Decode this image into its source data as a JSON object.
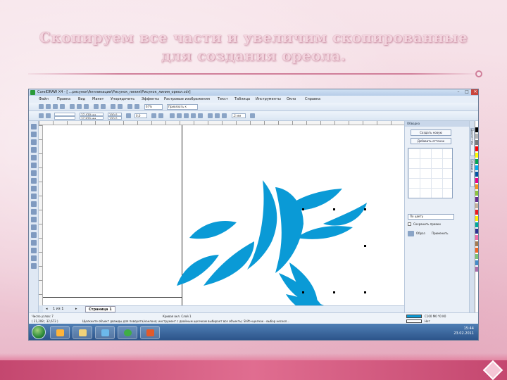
{
  "slide": {
    "title": "Скопируем все части и увеличим скопированные для создания ореола."
  },
  "window": {
    "title": "CorelDRAW X4 - [ ...рисунок\\Аппликации\\Рисунок_лилия\\Рисунок_лилия_ореол.cdr]",
    "minimize": "–",
    "maximize": "□",
    "close": "✕"
  },
  "menu": {
    "items": [
      "Файл",
      "Правка",
      "Вид",
      "Макет",
      "Упорядочить",
      "Эффекты",
      "Растровые изображения",
      "Текст",
      "Таблица",
      "Инструменты",
      "Окно",
      "Справка"
    ]
  },
  "toolbar": {
    "zoom": "67%",
    "snap": "Привязать к",
    "width": "37,438 мм",
    "height": "37,826 мм",
    "scale_w": "100,0",
    "scale_h": "100,0",
    "angle": "0,0",
    "outline": ".2 мм"
  },
  "page_tabs": {
    "counter": "1 из 1",
    "active_tab": "Страница 1"
  },
  "status": {
    "objects": "Число узлов: 7",
    "coords": "( 21,208 ; 32,673 )",
    "curve": "Кривая вкл. Слой 1",
    "hint": "Щелкните объект дважды для поворота/наклона; инструмент с двойным щелчком выбирает все объекты; Shift+щелчок - выбор нескол...",
    "fill_label": "C100 M0 Y0 K0",
    "outline_label": "Нет"
  },
  "docker": {
    "header": "Обводка",
    "add_button": "Создать новую",
    "edit_button": "Добавить оттенок",
    "select_value": "По цвету",
    "check_label": "Сохранить правки",
    "apply_label": "Применить",
    "preview_label": "Образ"
  },
  "side_tabs": [
    "Диспетчер объектов",
    "Обводка"
  ],
  "taskbar": {
    "time": "15:44",
    "date": "23.02.2011"
  },
  "colors": {
    "flower_fill": "#0a9ad6",
    "palette": [
      "#ffffff",
      "#000000",
      "#b5b5b5",
      "#7a7a7a",
      "#ff0000",
      "#ffff00",
      "#00a651",
      "#00aeef",
      "#0054a6",
      "#ec008c",
      "#f7941d",
      "#8dc63f",
      "#662d91",
      "#c7b299",
      "#ed1c24",
      "#fff200",
      "#00a99d",
      "#2e3192",
      "#f06eaa",
      "#a67c52",
      "#f26522",
      "#7cc576",
      "#448ccb",
      "#ab6dac"
    ]
  },
  "icons": {
    "app": "coreldraw-icon",
    "start": "windows-start-icon",
    "explorer": "folder-icon",
    "media": "media-player-icon",
    "corel": "coreldraw-taskbar-icon",
    "ie": "office-icon"
  }
}
